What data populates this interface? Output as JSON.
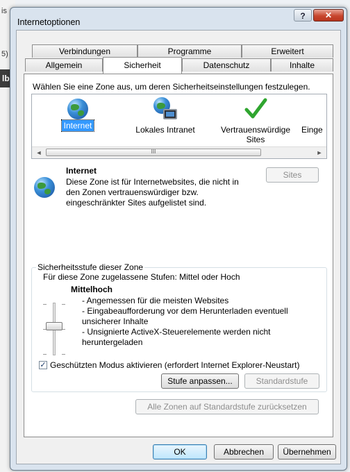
{
  "background": {
    "fragment_top": "5)",
    "fragment_dark": "lb",
    "fragment_mark": "is"
  },
  "window": {
    "title": "Internetoptionen",
    "help_glyph": "?",
    "close_glyph": "✕"
  },
  "tabs": {
    "row_back": [
      "Verbindungen",
      "Programme",
      "Erweitert"
    ],
    "row_front": [
      "Allgemein",
      "Sicherheit",
      "Datenschutz",
      "Inhalte"
    ],
    "active": "Sicherheit"
  },
  "zone_picker": {
    "instruction": "Wählen Sie eine Zone aus, um deren Sicherheitseinstellungen festzulegen.",
    "zones": [
      {
        "label": "Internet",
        "icon": "globe-icon",
        "selected": true
      },
      {
        "label": "Lokales Intranet",
        "icon": "intranet-icon",
        "selected": false
      },
      {
        "label_line1": "Vertrauenswürdige",
        "label_line2": "Sites",
        "icon": "checkmark-icon",
        "selected": false
      },
      {
        "label": "Einge",
        "icon": "restricted-icon",
        "selected": false
      }
    ],
    "scroll_left": "◄",
    "scroll_right": "►",
    "scroll_grip": "III"
  },
  "zone_info": {
    "title": "Internet",
    "line1": "Diese Zone ist für Internetwebsites, die nicht in",
    "line2": "den Zonen vertrauenswürdiger bzw.",
    "line3": "eingeschränkter Sites aufgelistet sind.",
    "sites_button": "Sites"
  },
  "security_level": {
    "group_title": "Sicherheitsstufe dieser Zone",
    "allowed_levels": "Für diese Zone zugelassene Stufen: Mittel oder Hoch",
    "level_name": "Mittelhoch",
    "desc": [
      "- Angemessen für die meisten Websites",
      "- Eingabeaufforderung vor dem Herunterladen eventuell",
      "unsicherer Inhalte",
      "- Unsignierte ActiveX-Steuerelemente werden nicht",
      "heruntergeladen"
    ],
    "protected_mode_label": "Geschützten Modus aktivieren (erfordert Internet Explorer-Neustart)",
    "protected_mode_checked": true,
    "check_glyph": "✓",
    "custom_level_button": "Stufe anpassen...",
    "default_level_button": "Standardstufe"
  },
  "reset_all_button": "Alle Zonen auf Standardstufe zurücksetzen",
  "footer": {
    "ok": "OK",
    "cancel": "Abbrechen",
    "apply": "Übernehmen"
  }
}
